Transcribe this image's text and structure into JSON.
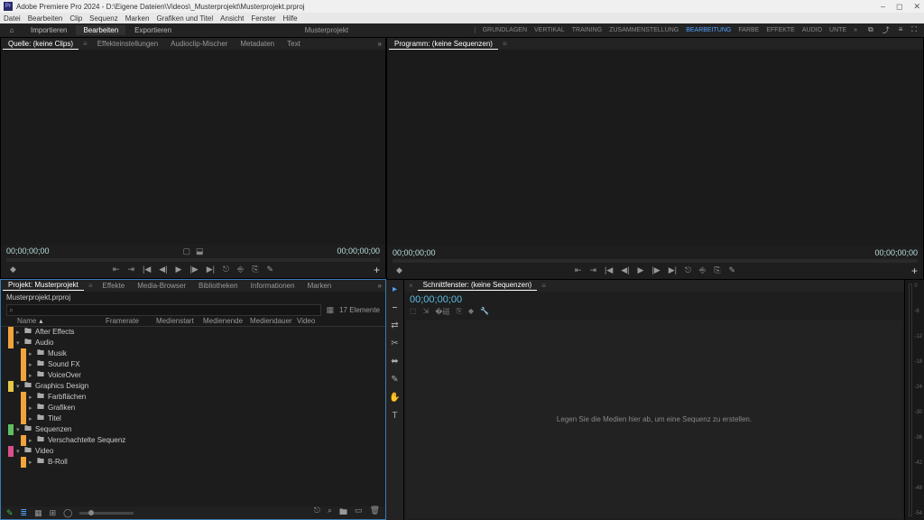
{
  "window": {
    "title": "Adobe Premiere Pro 2024 - D:\\Eigene Dateien\\Videos\\_Musterprojekt\\Musterprojekt.prproj"
  },
  "menu": [
    "Datei",
    "Bearbeiten",
    "Clip",
    "Sequenz",
    "Marken",
    "Grafiken und Titel",
    "Ansicht",
    "Fenster",
    "Hilfe"
  ],
  "topbar": {
    "modes": [
      "Importieren",
      "Bearbeiten",
      "Exportieren"
    ],
    "active_mode": "Bearbeiten",
    "project_name": "Musterprojekt",
    "workspaces": [
      "GRUNDLAGEN",
      "VERTIKAL",
      "TRAINING",
      "ZUSAMMENSTELLUNG",
      "BEARBEITUNG",
      "FARBE",
      "EFFEKTE",
      "AUDIO",
      "UNTE"
    ],
    "active_workspace": "BEARBEITUNG"
  },
  "source": {
    "tabs": [
      "Quelle: (keine Clips)",
      "Effekteinstellungen",
      "Audioclip-Mischer",
      "Metadaten",
      "Text"
    ],
    "active_tab": "Quelle: (keine Clips)",
    "tc_left": "00;00;00;00",
    "tc_right": "00;00;00;00"
  },
  "program": {
    "tab": "Programm: (keine Sequenzen)",
    "tc_left": "00;00;00;00",
    "tc_right": "00;00;00;00"
  },
  "project": {
    "tabs": [
      "Projekt: Musterprojekt",
      "Effekte",
      "Media-Browser",
      "Bibliotheken",
      "Informationen",
      "Marken"
    ],
    "active_tab": "Projekt: Musterprojekt",
    "filename": "Musterprojekt.prproj",
    "search_placeholder": "",
    "item_count": "17 Elemente",
    "columns": [
      "Name",
      "Framerate",
      "Medienstart",
      "Medienende",
      "Mediendauer",
      "Video"
    ],
    "items": [
      {
        "depth": 0,
        "expanded": false,
        "color": "#f2a33c",
        "label": "After Effects"
      },
      {
        "depth": 0,
        "expanded": true,
        "color": "#f2a33c",
        "label": "Audio"
      },
      {
        "depth": 1,
        "expanded": false,
        "color": "#f2a33c",
        "label": "Musik"
      },
      {
        "depth": 1,
        "expanded": false,
        "color": "#f2a33c",
        "label": "Sound FX"
      },
      {
        "depth": 1,
        "expanded": false,
        "color": "#f2a33c",
        "label": "VoiceOver"
      },
      {
        "depth": 0,
        "expanded": true,
        "color": "#e6c84a",
        "label": "Graphics Design"
      },
      {
        "depth": 1,
        "expanded": false,
        "color": "#f2a33c",
        "label": "Farbflächen"
      },
      {
        "depth": 1,
        "expanded": false,
        "color": "#f2a33c",
        "label": "Grafiken"
      },
      {
        "depth": 1,
        "expanded": false,
        "color": "#f2a33c",
        "label": "Titel"
      },
      {
        "depth": 0,
        "expanded": true,
        "color": "#5fbf5f",
        "label": "Sequenzen"
      },
      {
        "depth": 1,
        "expanded": false,
        "color": "#f2a33c",
        "label": "Verschachtelte Sequenz"
      },
      {
        "depth": 0,
        "expanded": true,
        "color": "#d94f8b",
        "label": "Video"
      },
      {
        "depth": 1,
        "expanded": false,
        "color": "#f2a33c",
        "label": "B-Roll"
      }
    ]
  },
  "timeline": {
    "tab": "Schnittfenster: (keine Sequenzen)",
    "tc": "00;00;00;00",
    "empty_msg": "Legen Sie die Medien hier ab, um eine Sequenz zu erstellen."
  },
  "audiometer": {
    "ticks": [
      "0",
      "-6",
      "-12",
      "-18",
      "-24",
      "-30",
      "-36",
      "-42",
      "-48",
      "-54"
    ]
  },
  "icons": {
    "home": "⌂",
    "search": "⌕",
    "bin": "▦",
    "min": "–",
    "max": "◻",
    "close": "✕",
    "export": "⤴",
    "quick": "≡",
    "full": "⛶",
    "overflow": "»",
    "mark": "◆",
    "in": "⇤",
    "out": "⇥",
    "goin": "|◀",
    "step_b": "◀|",
    "play": "▶",
    "step_f": "|▶",
    "goout": "▶|",
    "lift": "⎋",
    "extract": "⎆",
    "cam": "⎘",
    "snap": "✎",
    "add": "+",
    "wrench": "🔧",
    "folder": "🖿",
    "trash": "🗑",
    "new": "▭",
    "sel": "▸",
    "track": "⎯",
    "ripple": "⇄",
    "rate": "↔",
    "razor": "✂",
    "slip": "⬌",
    "pen": "✎",
    "hand": "✋",
    "type": "T"
  }
}
